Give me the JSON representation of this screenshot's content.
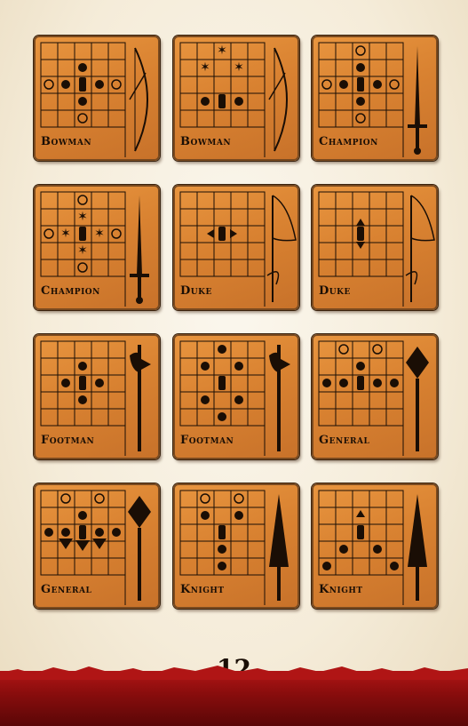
{
  "page_number": "12",
  "colors": {
    "tile": "#d98231",
    "ink": "#1a0e05",
    "footer": "#8a0d0d"
  },
  "tiles": [
    {
      "label": "Bowman",
      "weapon": "bow-icon"
    },
    {
      "label": "Bowman",
      "weapon": "bow-icon"
    },
    {
      "label": "Champion",
      "weapon": "sword-icon"
    },
    {
      "label": "Champion",
      "weapon": "sword-icon"
    },
    {
      "label": "Duke",
      "weapon": "banner-icon"
    },
    {
      "label": "Duke",
      "weapon": "banner-icon"
    },
    {
      "label": "Footman",
      "weapon": "halberd-icon"
    },
    {
      "label": "Footman",
      "weapon": "halberd-icon"
    },
    {
      "label": "General",
      "weapon": "mace-icon"
    },
    {
      "label": "General",
      "weapon": "mace-icon"
    },
    {
      "label": "Knight",
      "weapon": "lance-icon"
    },
    {
      "label": "Knight",
      "weapon": "lance-icon"
    }
  ]
}
